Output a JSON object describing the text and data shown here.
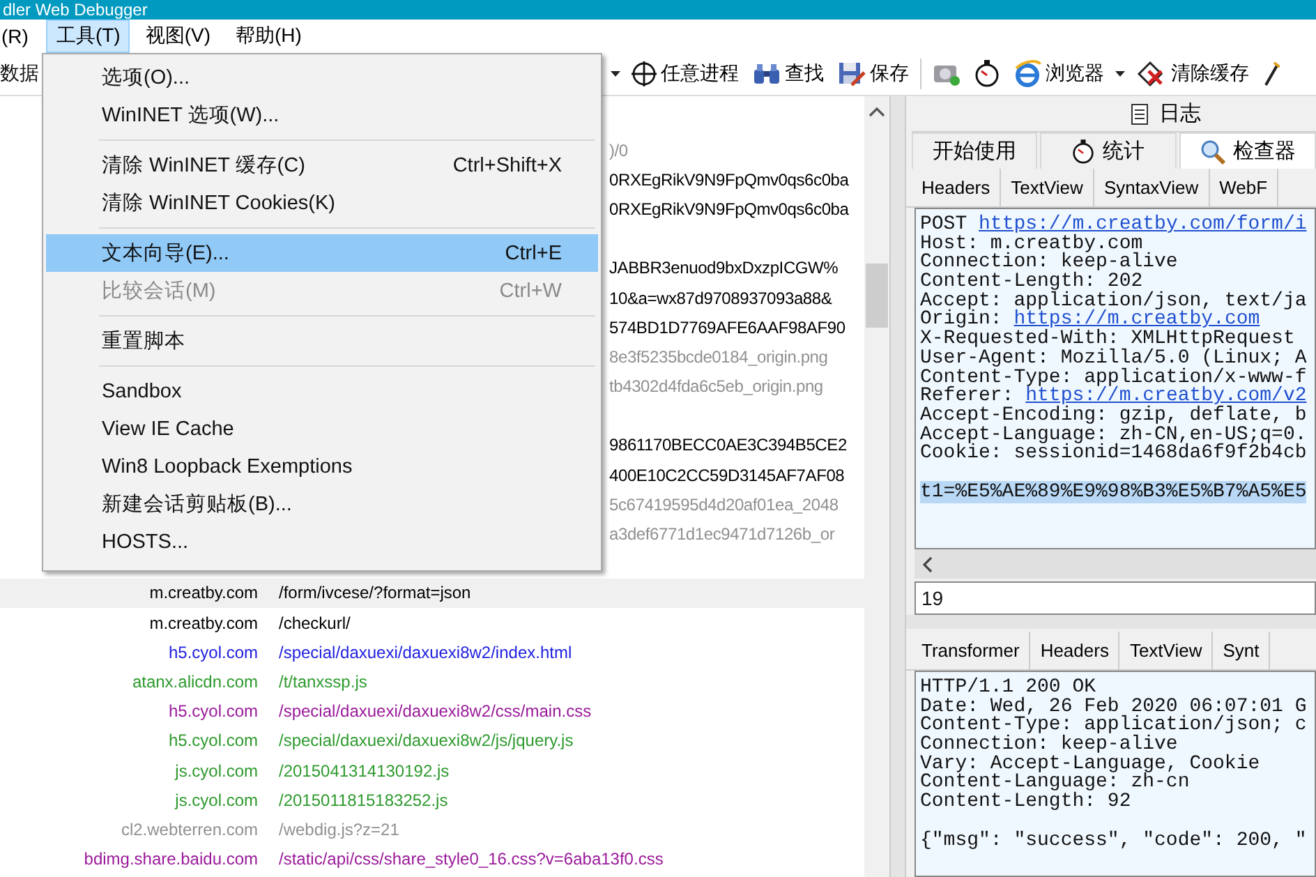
{
  "window": {
    "title": "dler Web Debugger"
  },
  "menu_bar": [
    {
      "label": "(R)",
      "selected": false
    },
    {
      "label": "工具(T)",
      "selected": true
    },
    {
      "label": "视图(V)",
      "selected": false
    },
    {
      "label": "帮助(H)",
      "selected": false
    }
  ],
  "toolbar": [
    {
      "kind": "text",
      "label": "数据"
    },
    {
      "kind": "caret"
    },
    {
      "kind": "crosshair",
      "label": "任意进程"
    },
    {
      "kind": "binoculars",
      "label": "查找"
    },
    {
      "kind": "save",
      "label": "保存"
    },
    {
      "kind": "separator"
    },
    {
      "kind": "camera"
    },
    {
      "kind": "timer"
    },
    {
      "kind": "browser",
      "label": "浏览器"
    },
    {
      "kind": "caret"
    },
    {
      "kind": "clear",
      "label": "清除缓存"
    },
    {
      "kind": "wand"
    }
  ],
  "tools_menu": [
    {
      "kind": "item",
      "label": "选项(O)...",
      "disabled": false,
      "selected": false
    },
    {
      "kind": "item",
      "label": "WinINET 选项(W)...",
      "disabled": false,
      "selected": false
    },
    {
      "kind": "separator"
    },
    {
      "kind": "item",
      "label": "清除 WinINET 缓存(C)",
      "shortcut": "Ctrl+Shift+X",
      "disabled": false,
      "selected": false
    },
    {
      "kind": "item",
      "label": "清除 WinINET Cookies(K)",
      "disabled": false,
      "selected": false
    },
    {
      "kind": "separator"
    },
    {
      "kind": "item",
      "label": "文本向导(E)...",
      "shortcut": "Ctrl+E",
      "disabled": false,
      "selected": true
    },
    {
      "kind": "item",
      "label": "比较会话(M)",
      "shortcut": "Ctrl+W",
      "disabled": true,
      "selected": false
    },
    {
      "kind": "separator"
    },
    {
      "kind": "item",
      "label": "重置脚本",
      "disabled": false,
      "selected": false
    },
    {
      "kind": "separator"
    },
    {
      "kind": "item",
      "label": "Sandbox",
      "disabled": false,
      "selected": false
    },
    {
      "kind": "item",
      "label": "View IE Cache",
      "disabled": false,
      "selected": false
    },
    {
      "kind": "item",
      "label": "Win8 Loopback Exemptions",
      "disabled": false,
      "selected": false
    },
    {
      "kind": "item",
      "label": "新建会话剪贴板(B)...",
      "disabled": false,
      "selected": false
    },
    {
      "kind": "item",
      "label": "HOSTS...",
      "disabled": false,
      "selected": false
    }
  ],
  "sessions": [
    {
      "kind": "covered",
      "url": ")/0",
      "color": "#909090",
      "selected": false
    },
    {
      "kind": "covered",
      "url": "0RXEgRikV9N9FpQmv0qs6c0ba",
      "color": "#000000",
      "selected": false
    },
    {
      "kind": "covered",
      "url": "0RXEgRikV9N9FpQmv0qs6c0ba",
      "color": "#000000",
      "selected": false
    },
    {
      "kind": "blank",
      "selected": false
    },
    {
      "kind": "covered",
      "url": "JABBR3enuod9bxDxzpICGW%",
      "color": "#000000",
      "selected": false
    },
    {
      "kind": "covered",
      "url": "10&a=wx87d9708937093a88&",
      "color": "#000000",
      "selected": false
    },
    {
      "kind": "covered",
      "url": "574BD1D7769AFE6AAF98AF90",
      "color": "#000000",
      "selected": false
    },
    {
      "kind": "covered",
      "url": "8e3f5235bcde0184_origin.png",
      "color": "#909090",
      "selected": false
    },
    {
      "kind": "covered",
      "url": "tb4302d4fda6c5eb_origin.png",
      "color": "#909090",
      "selected": false
    },
    {
      "kind": "blank",
      "selected": false
    },
    {
      "kind": "covered",
      "url": "9861170BECC0AE3C394B5CE2",
      "color": "#000000",
      "selected": false
    },
    {
      "kind": "covered",
      "url": "400E10C2CC59D3145AF7AF08",
      "color": "#000000",
      "selected": false
    },
    {
      "kind": "covered",
      "url": "5c67419595d4d20af01ea_2048",
      "color": "#909090",
      "selected": false
    },
    {
      "kind": "covered",
      "url": "a3def6771d1ec9471d7126b_or",
      "color": "#909090",
      "selected": false
    },
    {
      "kind": "blank",
      "selected": false
    },
    {
      "kind": "full",
      "host": "m.creatby.com",
      "url": "/form/ivcese/?format=json",
      "color": "#000000",
      "selected": true
    },
    {
      "kind": "full",
      "host": "m.creatby.com",
      "url": "/checkurl/",
      "color": "#000000",
      "selected": false
    },
    {
      "kind": "full",
      "host": "h5.cyol.com",
      "url": "/special/daxuexi/daxuexi8w2/index.html",
      "color": "#2020e0",
      "selected": false
    },
    {
      "kind": "full",
      "host": "atanx.alicdn.com",
      "url": "/t/tanxssp.js",
      "color": "#2e9a2e",
      "selected": false
    },
    {
      "kind": "full",
      "host": "h5.cyol.com",
      "url": "/special/daxuexi/daxuexi8w2/css/main.css",
      "color": "#9a1a9a",
      "selected": false
    },
    {
      "kind": "full",
      "host": "h5.cyol.com",
      "url": "/special/daxuexi/daxuexi8w2/js/jquery.js",
      "color": "#2e9a2e",
      "selected": false
    },
    {
      "kind": "full",
      "host": "js.cyol.com",
      "url": "/2015041314130192.js",
      "color": "#2e9a2e",
      "selected": false
    },
    {
      "kind": "full",
      "host": "js.cyol.com",
      "url": "/2015011815183252.js",
      "color": "#2e9a2e",
      "selected": false
    },
    {
      "kind": "full",
      "host": "cl2.webterren.com",
      "url": "/webdig.js?z=21",
      "color": "#909090",
      "selected": false
    },
    {
      "kind": "full",
      "host": "bdimg.share.baidu.com",
      "url": "/static/api/css/share_style0_16.css?v=6aba13f0.css",
      "color": "#9a1a9a",
      "selected": false
    }
  ],
  "top_tabs": [
    {
      "kind": "log",
      "label": "日志",
      "selected": false
    }
  ],
  "main_tabs": [
    {
      "kind": "plain",
      "label": "开始使用",
      "selected": false
    },
    {
      "kind": "timer",
      "label": "统计",
      "selected": false
    },
    {
      "kind": "inspect",
      "label": "检查器",
      "selected": true
    }
  ],
  "request_tabs": [
    {
      "label": "Headers",
      "selected": false
    },
    {
      "label": "TextView",
      "selected": false
    },
    {
      "label": "SyntaxView",
      "selected": false
    },
    {
      "label": "WebF",
      "selected": false
    }
  ],
  "request_lines": [
    {
      "kind": "header",
      "text": "POST ",
      "link": "https://m.creatby.com/form/i"
    },
    {
      "kind": "header",
      "text": "Host: m.creatby.com"
    },
    {
      "kind": "header",
      "text": "Connection: keep-alive"
    },
    {
      "kind": "header",
      "text": "Content-Length: 202"
    },
    {
      "kind": "header",
      "text": "Accept: application/json, text/ja"
    },
    {
      "kind": "header",
      "text": "Origin: ",
      "link": "https://m.creatby.com"
    },
    {
      "kind": "header",
      "text": "X-Requested-With: XMLHttpRequest"
    },
    {
      "kind": "header",
      "text": "User-Agent: Mozilla/5.0 (Linux; A"
    },
    {
      "kind": "header",
      "text": "Content-Type: application/x-www-f"
    },
    {
      "kind": "header",
      "text": "Referer: ",
      "link": "https://m.creatby.com/v2"
    },
    {
      "kind": "header",
      "text": "Accept-Encoding: gzip, deflate, b"
    },
    {
      "kind": "header",
      "text": "Accept-Language: zh-CN,en-US;q=0."
    },
    {
      "kind": "header",
      "text": "Cookie: sessionid=1468da6f9f2b4cb"
    },
    {
      "kind": "body",
      "text": "t1=%E5%AE%89%E9%98%B3%E5%B7%A5%E5",
      "selected": true
    }
  ],
  "quick_field": {
    "value": "19"
  },
  "response_tabs": [
    {
      "label": "Transformer",
      "selected": false
    },
    {
      "label": "Headers",
      "selected": false
    },
    {
      "label": "TextView",
      "selected": false
    },
    {
      "label": "Synt",
      "selected": false
    }
  ],
  "response_lines": [
    {
      "kind": "header",
      "text": "HTTP/1.1 200 OK"
    },
    {
      "kind": "header",
      "text": "Date: Wed, 26 Feb 2020 06:07:01 G"
    },
    {
      "kind": "header",
      "text": "Content-Type: application/json; c"
    },
    {
      "kind": "header",
      "text": "Connection: keep-alive"
    },
    {
      "kind": "header",
      "text": "Vary: Accept-Language, Cookie"
    },
    {
      "kind": "header",
      "text": "Content-Language: zh-cn"
    },
    {
      "kind": "header",
      "text": "Content-Length: 92"
    },
    {
      "kind": "body",
      "text": "{\"msg\": \"success\", \"code\": 200, \""
    }
  ]
}
